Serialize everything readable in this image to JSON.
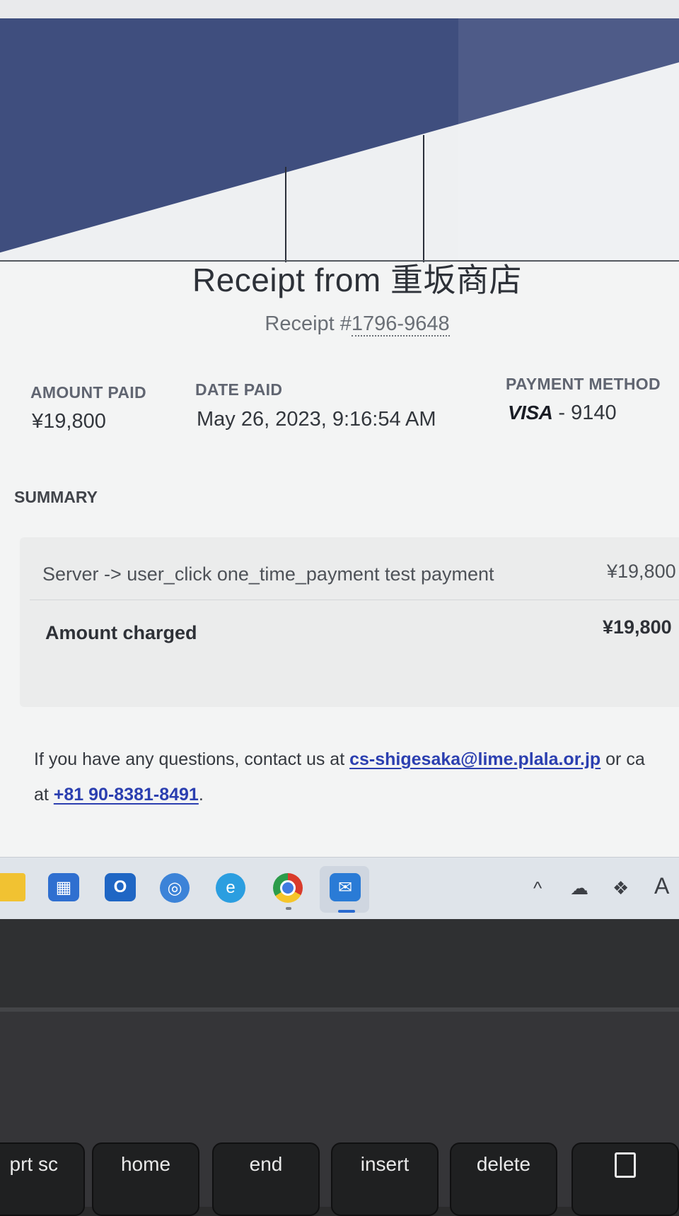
{
  "receipt": {
    "title": "Receipt from 重坂商店",
    "receipt_prefix": "Receipt #",
    "receipt_number": "1796-9648",
    "amount_paid_label": "AMOUNT PAID",
    "amount_paid": "¥19,800",
    "date_paid_label": "DATE PAID",
    "date_paid": "May 26, 2023, 9:16:54 AM",
    "payment_method_label": "PAYMENT METHOD",
    "card_brand": "VISA",
    "card_last4": "- 9140"
  },
  "summary": {
    "heading": "SUMMARY",
    "item_description": "Server -> user_click one_time_payment test payment",
    "item_amount": "¥19,800",
    "charged_label": "Amount charged",
    "charged_amount": "¥19,800"
  },
  "contact": {
    "line1_prefix": "If you have any questions, contact us at ",
    "email": "cs-shigesaka@lime.plala.or.jp",
    "line1_suffix": " or ca",
    "line2_prefix": "at ",
    "phone": "+81 90-8381-8491",
    "line2_suffix": "."
  },
  "taskbar": {
    "apps": [
      "file-explorer-icon",
      "microsoft-store-icon",
      "outlook-icon",
      "edge-icon",
      "edge-icon",
      "chrome-icon",
      "mail-icon"
    ],
    "tray_letter": "A"
  },
  "keyboard": {
    "keys": [
      "prt sc",
      "home",
      "end",
      "insert",
      "delete"
    ]
  },
  "colors": {
    "banner": "#3f4e7e",
    "link": "#2b3fb0"
  }
}
